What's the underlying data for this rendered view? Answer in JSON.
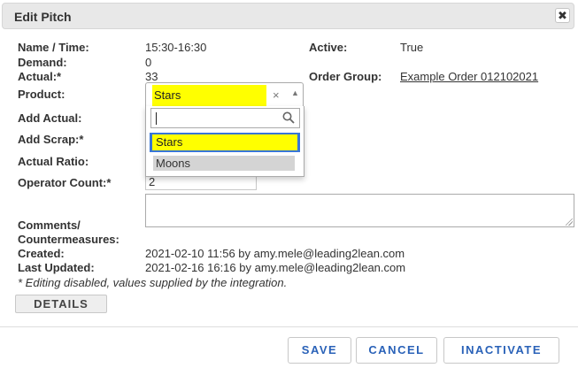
{
  "dialog": {
    "title": "Edit Pitch",
    "close_glyph": "✖"
  },
  "fields": {
    "name_time": {
      "label": "Name / Time:",
      "value": "15:30-16:30"
    },
    "demand": {
      "label": "Demand:",
      "value": "0"
    },
    "actual": {
      "label": "Actual:*",
      "value": "33"
    },
    "product": {
      "label": "Product:",
      "selected": "Stars"
    },
    "add_actual": {
      "label": "Add Actual:"
    },
    "add_scrap": {
      "label": "Add Scrap:*"
    },
    "actual_ratio": {
      "label": "Actual Ratio:"
    },
    "operator_count": {
      "label": "Operator Count:*",
      "value": "2"
    },
    "comments": {
      "label_line1": "Comments/",
      "label_line2": "Countermeasures:"
    },
    "created": {
      "label": "Created:",
      "value": "2021-02-10 11:56 by amy.mele@leading2lean.com"
    },
    "last_updated": {
      "label": "Last Updated:",
      "value": "2021-02-16 16:16 by amy.mele@leading2lean.com"
    },
    "active": {
      "label": "Active:",
      "value": "True"
    },
    "order_group": {
      "label": "Order Group:",
      "value": "Example Order 012102021"
    }
  },
  "dropdown": {
    "clear_glyph": "×",
    "arrow_glyph": "▲",
    "search_value": "",
    "options": [
      "Stars",
      "Moons"
    ]
  },
  "note": "* Editing disabled, values supplied by the integration.",
  "buttons": {
    "details": "DETAILS",
    "save": "SAVE",
    "cancel": "CANCEL",
    "inactivate": "INACTIVATE"
  },
  "colors": {
    "highlight": "#ffff00",
    "selected_option": "#3875d7",
    "button_text": "#2a62b8"
  },
  "icons": {
    "close": "close-icon",
    "search": "search-icon",
    "clear": "clear-icon",
    "arrow": "chevron-up-icon"
  }
}
